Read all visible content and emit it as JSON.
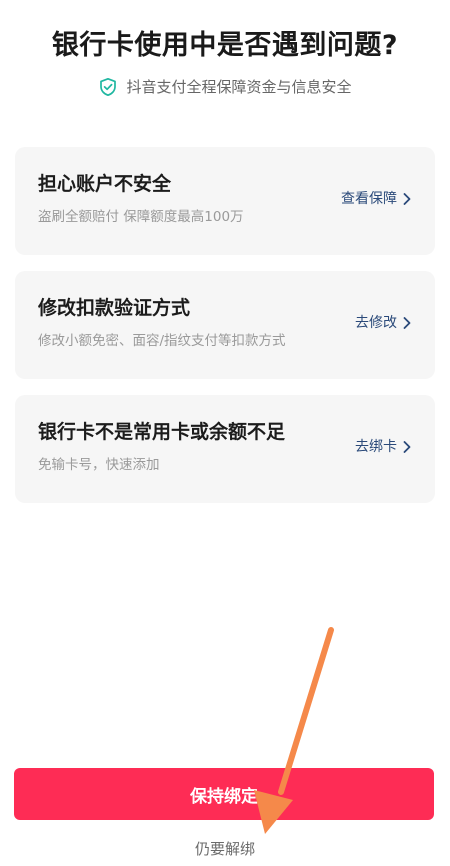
{
  "header": {
    "title": "银行卡使用中是否遇到问题?",
    "security_icon": "shield-check-icon",
    "security_text": "抖音支付全程保障资金与信息安全"
  },
  "cards": [
    {
      "title": "担心账户不安全",
      "description": "盗刷全额赔付 保障额度最高100万",
      "action": "查看保障"
    },
    {
      "title": "修改扣款验证方式",
      "description": "修改小额免密、面容/指纹支付等扣款方式",
      "action": "去修改"
    },
    {
      "title": "银行卡不是常用卡或余额不足",
      "description": "免输卡号，快速添加",
      "action": "去绑卡"
    }
  ],
  "footer": {
    "primary_label": "保持绑定",
    "secondary_label": "仍要解绑"
  },
  "colors": {
    "accent": "#fe2c55",
    "action_text": "#2b4a7a",
    "shield": "#20b7a1",
    "annotation_arrow": "#f5894a"
  }
}
